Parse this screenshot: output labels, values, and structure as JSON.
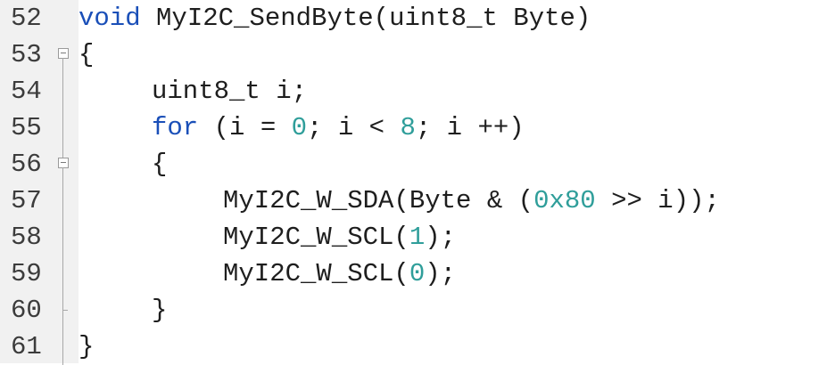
{
  "editor": {
    "lines": [
      {
        "number": "52",
        "tokens": [
          {
            "text": "void",
            "kind": "keyword"
          },
          {
            "text": " MyI2C_SendByte(uint8_t Byte)",
            "kind": "text"
          }
        ]
      },
      {
        "number": "53",
        "tokens": [
          {
            "text": "{",
            "kind": "text"
          }
        ]
      },
      {
        "number": "54",
        "tokens": [
          {
            "text": "uint8_t i;",
            "kind": "text"
          }
        ]
      },
      {
        "number": "55",
        "tokens": [
          {
            "text": "for",
            "kind": "keyword"
          },
          {
            "text": " (i = ",
            "kind": "text"
          },
          {
            "text": "0",
            "kind": "number"
          },
          {
            "text": "; i < ",
            "kind": "text"
          },
          {
            "text": "8",
            "kind": "number"
          },
          {
            "text": "; i ++)",
            "kind": "text"
          }
        ]
      },
      {
        "number": "56",
        "tokens": [
          {
            "text": "{",
            "kind": "text"
          }
        ]
      },
      {
        "number": "57",
        "tokens": [
          {
            "text": "MyI2C_W_SDA(Byte & (",
            "kind": "text"
          },
          {
            "text": "0x80",
            "kind": "number"
          },
          {
            "text": " >> i));",
            "kind": "text"
          }
        ]
      },
      {
        "number": "58",
        "tokens": [
          {
            "text": "MyI2C_W_SCL(",
            "kind": "text"
          },
          {
            "text": "1",
            "kind": "number"
          },
          {
            "text": ");",
            "kind": "text"
          }
        ]
      },
      {
        "number": "59",
        "tokens": [
          {
            "text": "MyI2C_W_SCL(",
            "kind": "text"
          },
          {
            "text": "0",
            "kind": "number"
          },
          {
            "text": ");",
            "kind": "text"
          }
        ]
      },
      {
        "number": "60",
        "tokens": [
          {
            "text": "}",
            "kind": "text"
          }
        ]
      },
      {
        "number": "61",
        "tokens": [
          {
            "text": "}",
            "kind": "text"
          }
        ]
      }
    ]
  },
  "colors": {
    "keyword": "#1a4fb8",
    "number": "#2f9e9a",
    "text": "#1e1e1e",
    "gutter_background": "#f1f1f1"
  }
}
